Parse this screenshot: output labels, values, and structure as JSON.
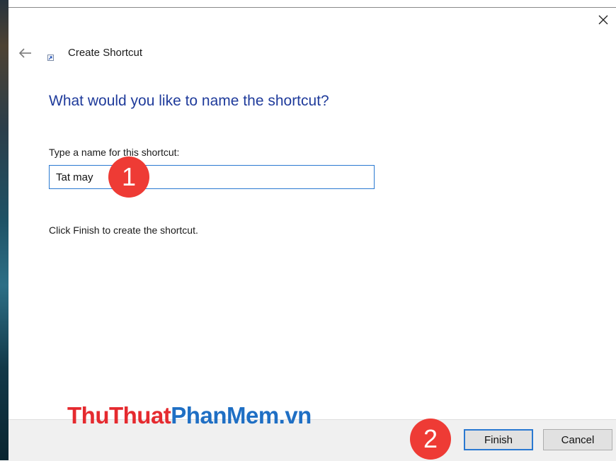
{
  "window": {
    "title": "Create Shortcut"
  },
  "wizard": {
    "heading": "What would you like to name the shortcut?",
    "name_label": "Type a name for this shortcut:",
    "name_value": "Tat may",
    "hint": "Click Finish to create the shortcut."
  },
  "footer": {
    "finish_label": "Finish",
    "cancel_label": "Cancel"
  },
  "annotations": {
    "marker_1": "1",
    "marker_2": "2"
  },
  "watermark": {
    "part_red": "ThuThuat",
    "part_blue": "PhanMem.vn"
  },
  "icons": {
    "back": "back-arrow-icon",
    "close": "close-icon",
    "shortcut": "shortcut-icon"
  },
  "colors": {
    "heading": "#1f3b9b",
    "focus": "#2a79d1",
    "marker": "#ee3b35",
    "watermark_red": "#e52a2f",
    "watermark_blue": "#1f6fc4"
  }
}
